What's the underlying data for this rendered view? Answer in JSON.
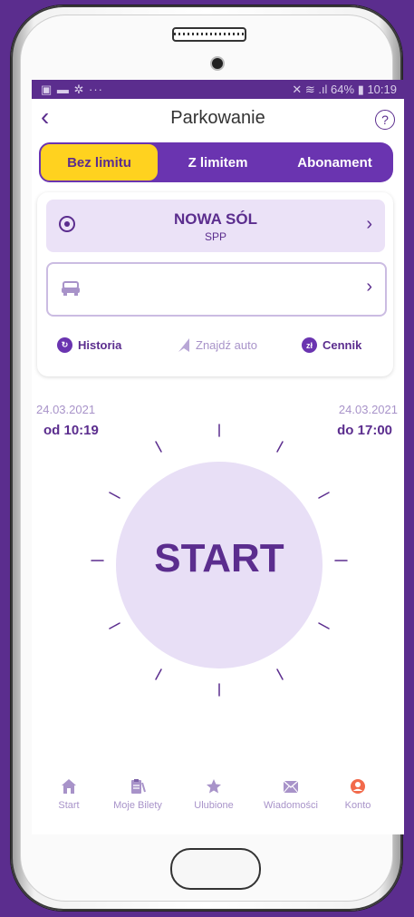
{
  "status": {
    "left": "▣ ▬ ✲ ···",
    "right": "✕ ≋ .ıl 64% ▮ 10:19"
  },
  "header": {
    "title": "Parkowanie",
    "help": "?"
  },
  "tabs": [
    {
      "label": "Bez limitu",
      "active": true
    },
    {
      "label": "Z limitem",
      "active": false
    },
    {
      "label": "Abonament",
      "active": false
    }
  ],
  "location": {
    "name": "NOWA SÓL",
    "sub": "SPP"
  },
  "actions": {
    "history": "Historia",
    "find_car": "Znajdź auto",
    "pricing": "Cennik",
    "pricing_icon": "zł"
  },
  "times": {
    "start_date": "24.03.2021",
    "start_time": "od 10:19",
    "end_date": "24.03.2021",
    "end_time": "do 17:00"
  },
  "start_label": "START",
  "nav": [
    {
      "label": "Start",
      "icon": "home-icon"
    },
    {
      "label": "Moje Bilety",
      "icon": "tickets-icon"
    },
    {
      "label": "Ulubione",
      "icon": "star-icon"
    },
    {
      "label": "Wiadomości",
      "icon": "mail-icon"
    },
    {
      "label": "Konto",
      "icon": "account-icon"
    }
  ],
  "colors": {
    "primary": "#5b2d8e",
    "accent": "#ffd21f",
    "light": "#e8dff6",
    "account": "#f26a4b"
  }
}
